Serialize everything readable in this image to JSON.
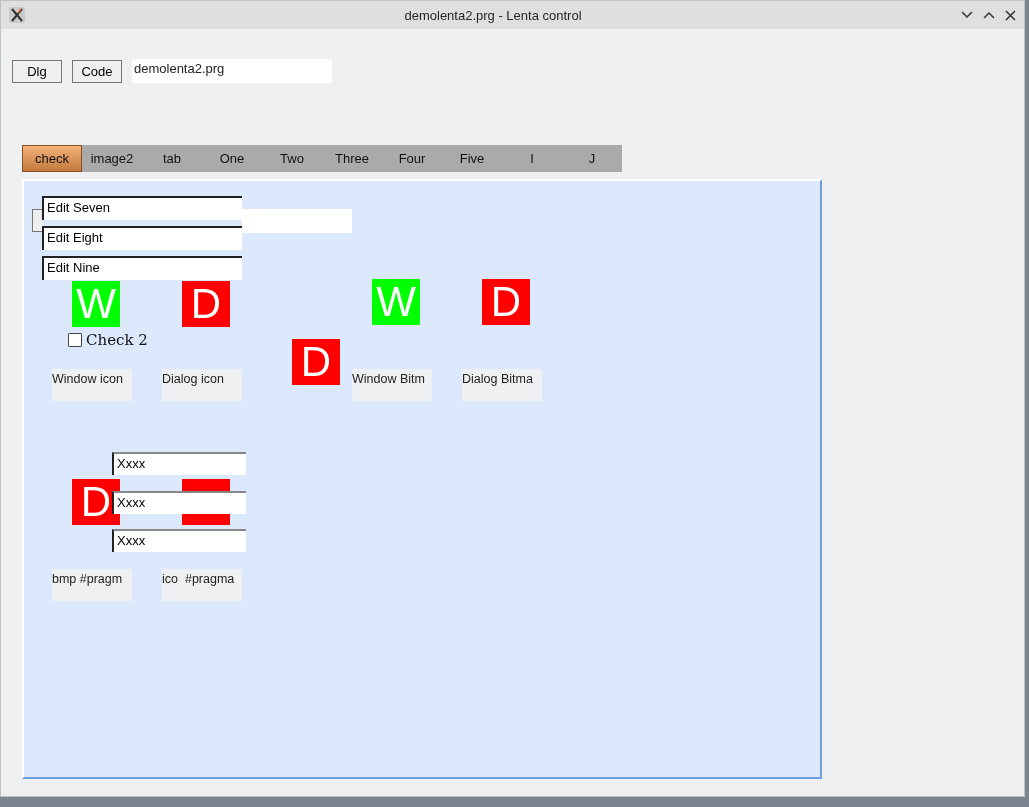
{
  "window": {
    "title": "demolenta2.prg - Lenta control"
  },
  "toolbar": {
    "buttons": [
      "Dlg",
      "Code"
    ],
    "field_value": "demolenta2.prg"
  },
  "tabs": [
    {
      "label": "check",
      "selected": true
    },
    {
      "label": "image2",
      "selected": false
    },
    {
      "label": "tab",
      "selected": false
    },
    {
      "label": "One",
      "selected": false
    },
    {
      "label": "Two",
      "selected": false
    },
    {
      "label": "Three",
      "selected": false
    },
    {
      "label": "Four",
      "selected": false
    },
    {
      "label": "Five",
      "selected": false
    },
    {
      "label": "I",
      "selected": false
    },
    {
      "label": "J",
      "selected": false
    }
  ],
  "panel": {
    "edits": [
      "Edit Seven",
      "Edit Eight",
      "Edit Nine"
    ],
    "images": [
      {
        "letter": "W",
        "color": "#00ff00"
      },
      {
        "letter": "D",
        "color": "#ff0000"
      },
      {
        "letter": "W",
        "color": "#00ff00"
      },
      {
        "letter": "D",
        "color": "#ff0000"
      },
      {
        "letter": "D",
        "color": "#ff0000"
      },
      {
        "letter": "D",
        "color": "#ff0000"
      },
      {
        "color": "#ff0000"
      }
    ],
    "checkbox": {
      "label": "Check 2",
      "checked": false
    },
    "captions": [
      "Window icon",
      "Dialog icon",
      "Window Bitm",
      "Dialog Bitma",
      "bmp #pragm",
      "ico  #pragma"
    ],
    "x_fields": [
      "Xxxx",
      "Xxxx",
      "Xxxx"
    ]
  }
}
